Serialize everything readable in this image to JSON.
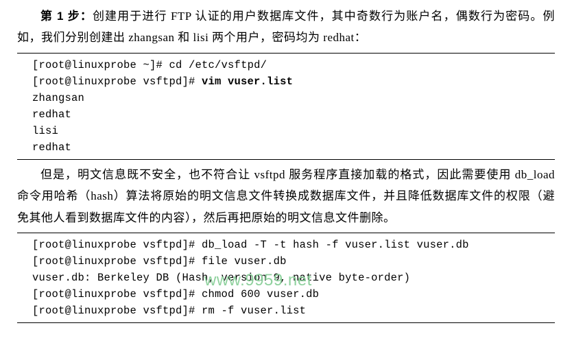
{
  "para1": {
    "step_label": "第 1 步：",
    "text_after_label": "创建用于进行 FTP 认证的用户数据库文件，其中奇数行为账户名，偶数行为密码。例如，我们分别创建出 zhangsan 和 lisi 两个用户，密码均为 redhat："
  },
  "code1": {
    "lines": [
      {
        "prompt": "[root@linuxprobe ~]# ",
        "cmd": "cd /etc/vsftpd/",
        "bold_cmd": false
      },
      {
        "prompt": "[root@linuxprobe vsftpd]# ",
        "cmd": "vim vuser.list",
        "bold_cmd": true
      },
      {
        "prompt": "",
        "cmd": "zhangsan",
        "bold_cmd": false
      },
      {
        "prompt": "",
        "cmd": "redhat",
        "bold_cmd": false
      },
      {
        "prompt": "",
        "cmd": "lisi",
        "bold_cmd": false
      },
      {
        "prompt": "",
        "cmd": "redhat",
        "bold_cmd": false
      }
    ]
  },
  "para2": {
    "text": "但是，明文信息既不安全，也不符合让 vsftpd 服务程序直接加载的格式，因此需要使用 db_load 命令用哈希（hash）算法将原始的明文信息文件转换成数据库文件，并且降低数据库文件的权限（避免其他人看到数据库文件的内容），然后再把原始的明文信息文件删除。"
  },
  "code2": {
    "lines": [
      {
        "prompt": "[root@linuxprobe vsftpd]# ",
        "cmd": "db_load -T -t hash -f vuser.list vuser.db",
        "bold_cmd": false
      },
      {
        "prompt": "[root@linuxprobe vsftpd]# ",
        "cmd": "file vuser.db",
        "bold_cmd": false
      },
      {
        "prompt": "",
        "cmd": "vuser.db: Berkeley DB (Hash, version 9, native byte-order)",
        "bold_cmd": false
      },
      {
        "prompt": "[root@linuxprobe vsftpd]# ",
        "cmd": "chmod 600 vuser.db",
        "bold_cmd": false
      },
      {
        "prompt": "[root@linuxprobe vsftpd]# ",
        "cmd": "rm -f vuser.list",
        "bold_cmd": false
      }
    ]
  },
  "watermark": {
    "text": "www.9959.net"
  }
}
